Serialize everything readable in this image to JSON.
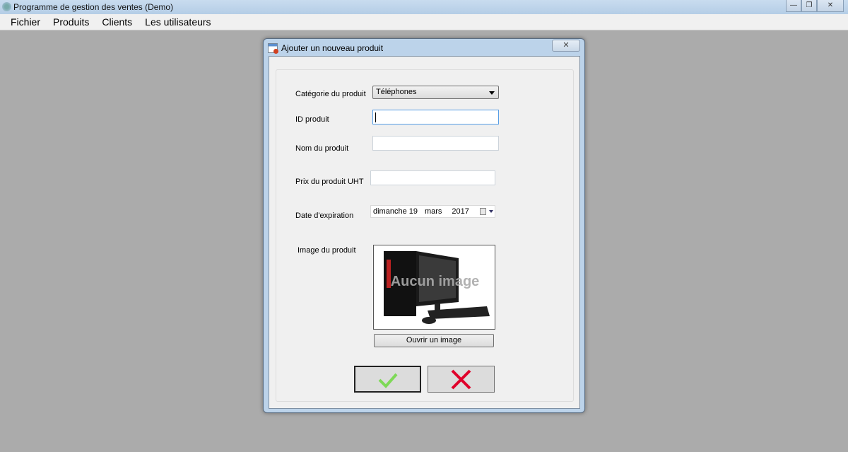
{
  "window": {
    "title": "Programme de gestion des ventes (Demo)",
    "minimize": "—",
    "restore": "❐",
    "close": "✕"
  },
  "menu": [
    "Fichier",
    "Produits",
    "Clients",
    "Les utilisateurs"
  ],
  "dialog": {
    "title": "Ajouter un nouveau produit",
    "close": "✕",
    "category_label": "Catégorie du produit",
    "category_value": "Téléphones",
    "id_label": "ID produit",
    "id_value": "",
    "name_label": "Nom du produit",
    "name_value": "",
    "price_label": "Prix du produit UHT",
    "price_value": "",
    "expiry_label": "Date d'expiration",
    "expiry": {
      "weekday": "dimanche",
      "day": "19",
      "month": "mars",
      "year": "2017"
    },
    "image_label": "Image du produit",
    "image_placeholder": "Aucun image",
    "open_image": "Ouvrir un image",
    "colors": {
      "ok": "#7ed957",
      "cancel": "#e0002a"
    }
  }
}
